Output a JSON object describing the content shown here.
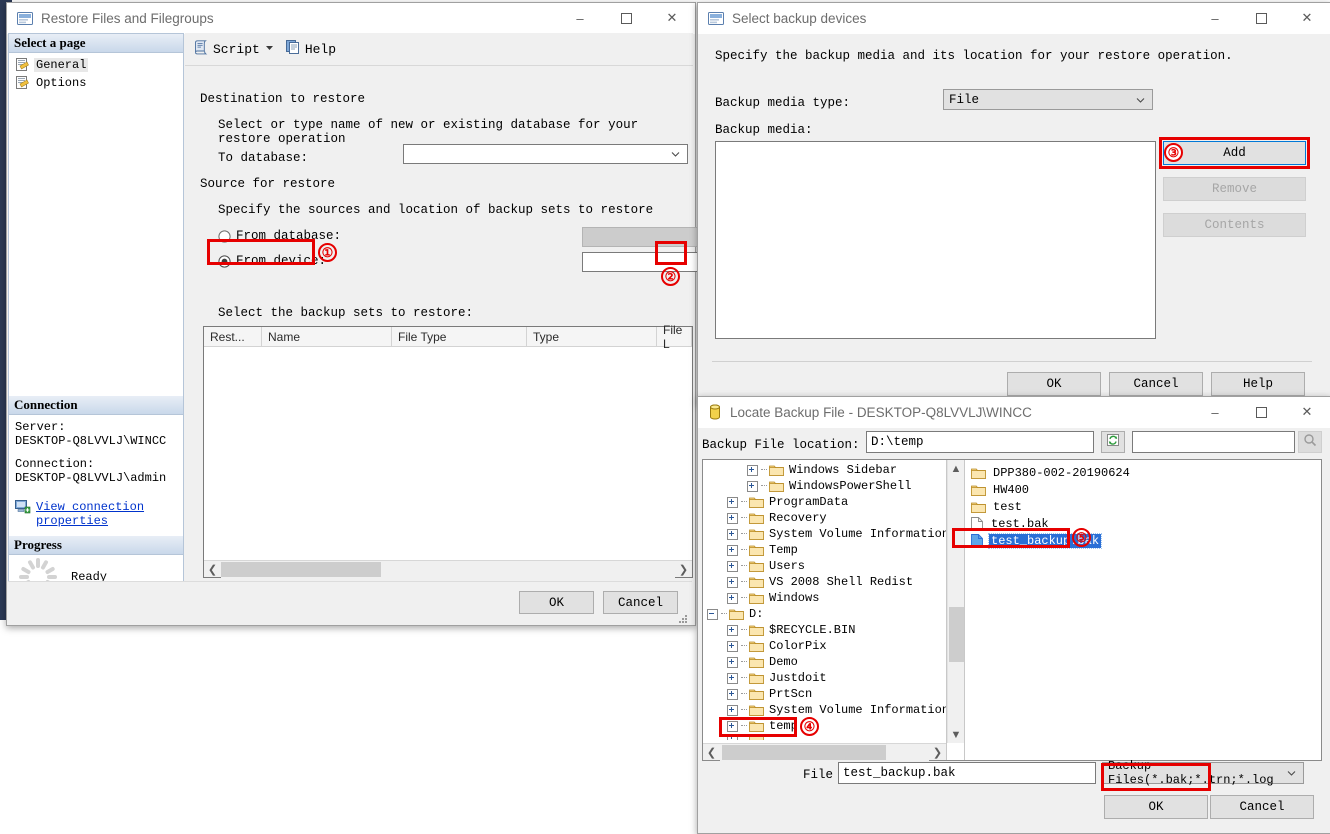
{
  "restore_window": {
    "title": "Restore Files and Filegroups",
    "title_icon": "window-restore-icon",
    "min_label": "–",
    "max_label": "☐",
    "close_label": "✕",
    "sidebar": {
      "header": "Select a page",
      "items": [
        {
          "label": "General",
          "icon": "page-icon",
          "selected": true
        },
        {
          "label": "Options",
          "icon": "page-icon",
          "selected": false
        }
      ],
      "connection": {
        "header": "Connection",
        "server_label": "Server:",
        "server_value": "DESKTOP-Q8LVVLJ\\WINCC",
        "connection_label": "Connection:",
        "connection_value": "DESKTOP-Q8LVVLJ\\admin",
        "link_line1": "View connection",
        "link_line2": "properties",
        "link_icon": "connection-properties-icon"
      },
      "progress": {
        "header": "Progress",
        "status": "Ready",
        "spinner_icon": "progress-spinner-icon"
      }
    },
    "toolbar": {
      "script_label": "Script",
      "script_icon": "script-icon",
      "script_dropdown_icon": "chevron-down-icon",
      "help_label": "Help",
      "help_icon": "help-icon"
    },
    "form": {
      "destination_group": "Destination to restore",
      "destination_hint": "Select or type name of new or existing database for your restore operation",
      "to_database_label": "To database:",
      "to_database_value": "",
      "source_group": "Source for restore",
      "source_hint": "Specify the sources and location of backup sets to restore",
      "from_database_label": "From database:",
      "from_database_value": "",
      "from_database_checked": false,
      "from_device_label": "From device:",
      "from_device_value": "",
      "from_device_checked": true,
      "browse_button_label": "...",
      "backup_sets_label": "Select the backup sets to restore:"
    },
    "grid": {
      "columns": [
        "Rest...",
        "Name",
        "File Type",
        "Type",
        "File L"
      ],
      "rows": []
    },
    "buttons": {
      "ok": "OK",
      "cancel": "Cancel"
    }
  },
  "devices_window": {
    "title": "Select backup devices",
    "title_icon": "window-restore-icon",
    "min_label": "–",
    "max_label": "☐",
    "close_label": "✕",
    "description": "Specify the backup media and its location for your restore operation.",
    "media_type_label": "Backup media type:",
    "media_type_value": "File",
    "media_label": "Backup media:",
    "media_items": [],
    "buttons": {
      "add": "Add",
      "remove": "Remove",
      "contents": "Contents",
      "ok": "OK",
      "cancel": "Cancel",
      "help": "Help"
    }
  },
  "locate_window": {
    "title": "Locate Backup File - DESKTOP-Q8LVVLJ\\WINCC",
    "title_icon": "database-cylinder-icon",
    "min_label": "–",
    "max_label": "☐",
    "close_label": "✕",
    "location_label": "Backup File location:",
    "location_value": "D:\\temp",
    "refresh_icon": "refresh-icon",
    "search_value": "",
    "search_icon": "search-icon",
    "tree": [
      {
        "label": "Windows Sidebar",
        "indent": 2,
        "expandable": true
      },
      {
        "label": "WindowsPowerShell",
        "indent": 2,
        "expandable": true
      },
      {
        "label": "ProgramData",
        "indent": 1,
        "expandable": true
      },
      {
        "label": "Recovery",
        "indent": 1,
        "expandable": true
      },
      {
        "label": "System Volume Information",
        "indent": 1,
        "expandable": true
      },
      {
        "label": "Temp",
        "indent": 1,
        "expandable": true
      },
      {
        "label": "Users",
        "indent": 1,
        "expandable": true
      },
      {
        "label": "VS 2008 Shell Redist",
        "indent": 1,
        "expandable": true
      },
      {
        "label": "Windows",
        "indent": 1,
        "expandable": true
      },
      {
        "label": "D:",
        "indent": 0,
        "expandable": true,
        "expanded": true
      },
      {
        "label": "$RECYCLE.BIN",
        "indent": 1,
        "expandable": true
      },
      {
        "label": "ColorPix",
        "indent": 1,
        "expandable": true
      },
      {
        "label": "Demo",
        "indent": 1,
        "expandable": true
      },
      {
        "label": "Justdoit",
        "indent": 1,
        "expandable": true
      },
      {
        "label": "PrtScn",
        "indent": 1,
        "expandable": true
      },
      {
        "label": "System Volume Information",
        "indent": 1,
        "expandable": true
      },
      {
        "label": "temp",
        "indent": 1,
        "expandable": true,
        "highlighted": true
      }
    ],
    "files": [
      {
        "name": "DPP380-002-20190624",
        "type": "folder",
        "selected": false
      },
      {
        "name": "HW400",
        "type": "folder",
        "selected": false
      },
      {
        "name": "test",
        "type": "folder",
        "selected": false
      },
      {
        "name": "test.bak",
        "type": "file",
        "selected": false
      },
      {
        "name": "test_backup.bak",
        "type": "file",
        "selected": true
      }
    ],
    "file_name_label": "File name:",
    "file_name_value": "test_backup.bak",
    "filter_value": "Backup Files(*.bak;*.trn;*.log",
    "buttons": {
      "ok": "OK",
      "cancel": "Cancel"
    }
  },
  "annotations": {
    "markers": [
      {
        "id": "1",
        "text": "①",
        "target": "from-device-radio"
      },
      {
        "id": "2",
        "text": "②",
        "target": "browse-device-button"
      },
      {
        "id": "3",
        "text": "③",
        "target": "add-button"
      },
      {
        "id": "4",
        "text": "④",
        "target": "tree-item-temp"
      },
      {
        "id": "5",
        "text": "⑤",
        "target": "file-test-backup-bak"
      }
    ],
    "highlight_color": "#e60000"
  }
}
